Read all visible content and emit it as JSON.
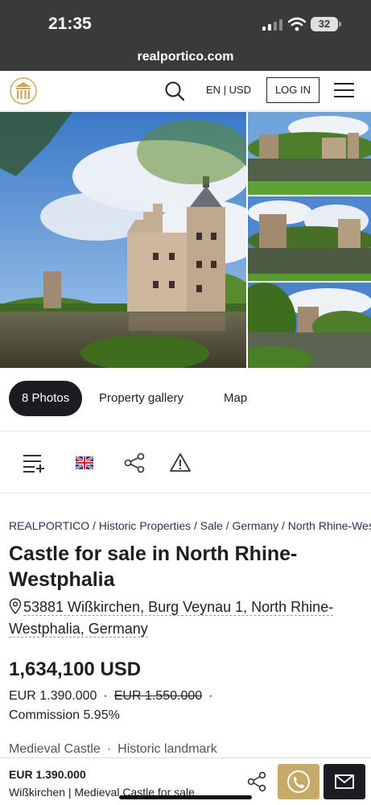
{
  "status_bar": {
    "time": "21:35",
    "battery": "32",
    "url": "realportico.com"
  },
  "header": {
    "lang": "EN | USD",
    "login_label": "LOG IN",
    "logo_icon": "portico-columns-icon",
    "brand_color": "#c7a96a"
  },
  "gallery_tabs": [
    {
      "label": "8 Photos",
      "active": true
    },
    {
      "label": "Property gallery",
      "active": false
    },
    {
      "label": "Map",
      "active": false
    }
  ],
  "tools": [
    "add-to-list-icon",
    "uk-flag-icon",
    "share-icon",
    "warning-icon"
  ],
  "breadcrumb": "REALPORTICO / Historic Properties / Sale / Germany / North Rhine-Westphalia",
  "title": "Castle for sale in North Rhine-Westphalia",
  "address": "53881 Wißkirchen, Burg Veynau 1, North Rhine-Westphalia, Germany",
  "price": {
    "main": "1,634,100 USD",
    "eur": "EUR 1.390.000",
    "old_eur": "EUR 1.550.000",
    "commission": "Commission 5.95%"
  },
  "tags": [
    "Medieval Castle",
    "Historic landmark"
  ],
  "bottom_bar": {
    "price": "EUR 1.390.000",
    "subtitle": "Wißkirchen | Medieval Castle for sale",
    "call_color": "#c7a96a",
    "mail_color": "#1b1b22"
  }
}
